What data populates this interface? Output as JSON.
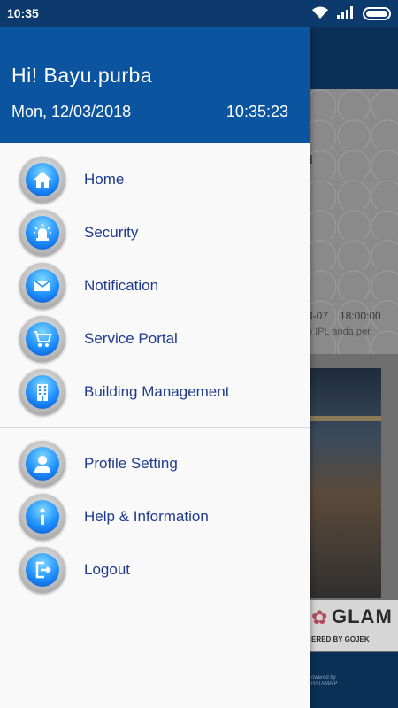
{
  "status_bar": {
    "time": "10:35",
    "icons": [
      "wifi-icon",
      "signal-icon",
      "battery-icon"
    ]
  },
  "background": {
    "hex_title": "N",
    "date": "3-07",
    "time": "18:00:00",
    "desc": "n IPL anda per",
    "promo_brand": "GLAM",
    "promo_powered": "ERED BY GOJEK",
    "footer_text": "owered by RATAMA P"
  },
  "drawer": {
    "greeting": "Hi! Bayu.purba",
    "date": "Mon, 12/03/2018",
    "time": "10:35:23",
    "colors": {
      "header": "#0b55a0",
      "label": "#1f3a8f"
    },
    "items": [
      {
        "label": "Home",
        "icon": "home-icon"
      },
      {
        "label": "Security",
        "icon": "alarm-siren-icon"
      },
      {
        "label": "Notification",
        "icon": "envelope-icon"
      },
      {
        "label": "Service Portal",
        "icon": "shopping-cart-icon"
      },
      {
        "label": "Building Management",
        "icon": "building-icon"
      },
      {
        "label": "Profile Setting",
        "icon": "user-icon"
      },
      {
        "label": "Help & Information",
        "icon": "info-icon"
      },
      {
        "label": "Logout",
        "icon": "logout-icon"
      }
    ]
  }
}
